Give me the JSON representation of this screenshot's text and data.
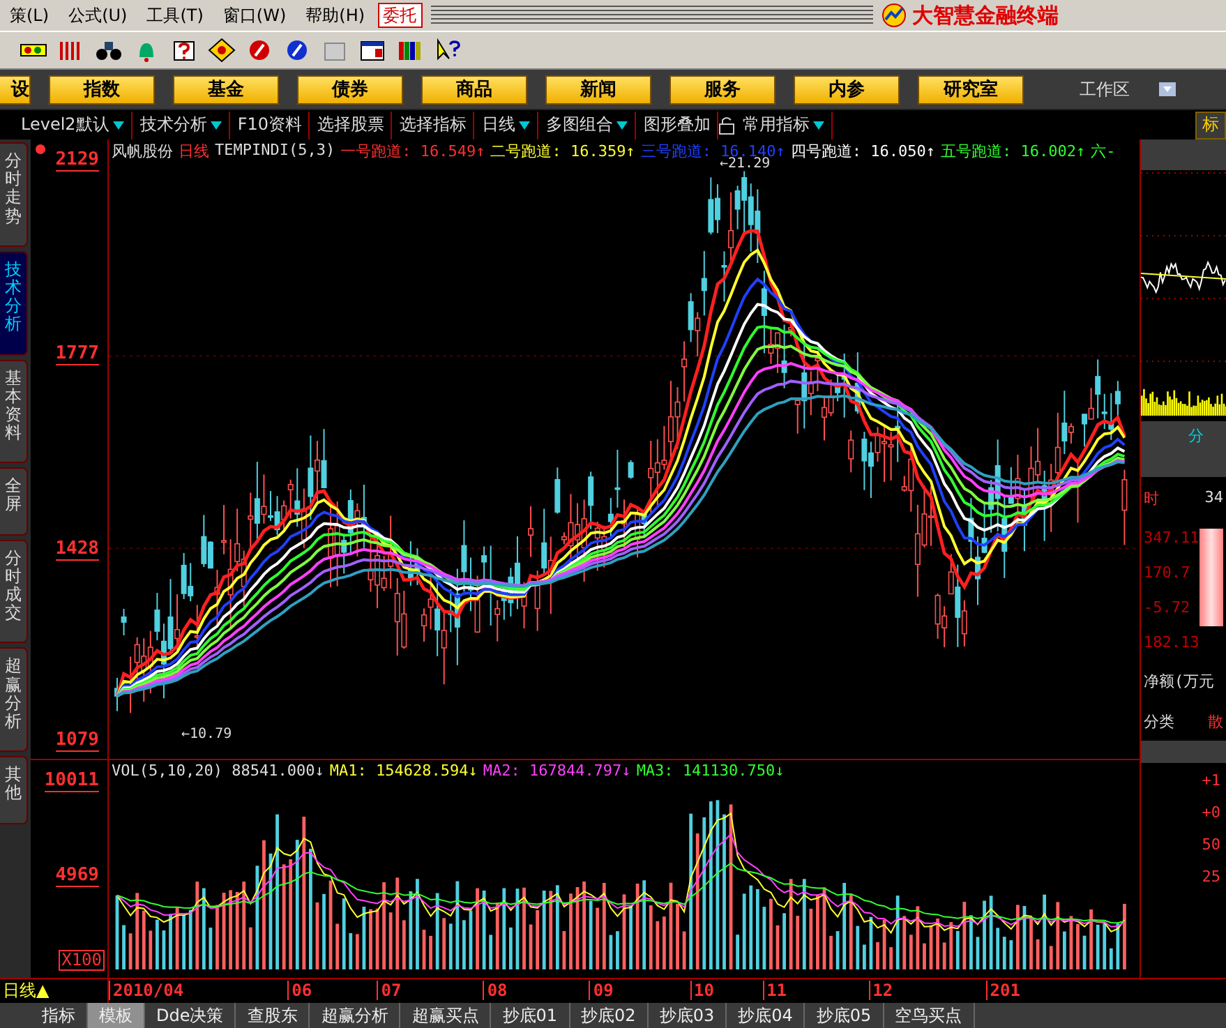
{
  "menu": [
    {
      "label": "策(L)"
    },
    {
      "label": "公式(U)"
    },
    {
      "label": "工具(T)"
    },
    {
      "label": "窗口(W)"
    },
    {
      "label": "帮助(H)"
    }
  ],
  "order_button": "委托",
  "logo": "大智慧金融终端",
  "nav_buttons": [
    "设",
    "指数",
    "基金",
    "债券",
    "商品",
    "新闻",
    "服务",
    "内参",
    "研究室"
  ],
  "workspace": "工作区",
  "tabs": [
    {
      "label": "Level2默认",
      "dropdown": true
    },
    {
      "label": "技术分析",
      "dropdown": true
    },
    {
      "label": "F10资料",
      "dropdown": false
    },
    {
      "label": "选择股票",
      "dropdown": false
    },
    {
      "label": "选择指标",
      "dropdown": false
    },
    {
      "label": "日线",
      "dropdown": true
    },
    {
      "label": "多图组合",
      "dropdown": true
    },
    {
      "label": "图形叠加",
      "dropdown": false
    },
    {
      "label": "常用指标",
      "dropdown": true
    }
  ],
  "side_tabs": [
    {
      "label": "分时走势",
      "selected": false
    },
    {
      "label": "技术分析",
      "selected": true
    },
    {
      "label": "基本资料",
      "selected": false
    },
    {
      "label": "全屏",
      "selected": false
    },
    {
      "label": "分时成交",
      "selected": false
    },
    {
      "label": "超赢分析",
      "selected": false
    },
    {
      "label": "其他",
      "selected": false
    }
  ],
  "chart": {
    "stock": "风帆股份",
    "period": "日线",
    "indicator": "TEMPINDI(5,3)",
    "lines": [
      {
        "label": "一号跑道:",
        "value": "16.549↑",
        "color": "#ff3030"
      },
      {
        "label": "二号跑道:",
        "value": "16.359↑",
        "color": "#ffff30"
      },
      {
        "label": "三号跑道:",
        "value": "16.140↑",
        "color": "#2040ff"
      },
      {
        "label": "四号跑道:",
        "value": "16.050↑",
        "color": "#ffffff"
      },
      {
        "label": "五号跑道:",
        "value": "16.002↑",
        "color": "#30ff30"
      },
      {
        "label": "六-",
        "color": "#30ff30"
      }
    ],
    "price_axis": [
      "2129",
      "1777",
      "1428",
      "1079"
    ],
    "high_note": "←21.29",
    "low_note": "←10.79"
  },
  "volume": {
    "label": "VOL(5,10,20)",
    "value": "88541.000↓",
    "mas": [
      {
        "label": "MA1:",
        "value": "154628.594↓",
        "color": "#ffff30"
      },
      {
        "label": "MA2:",
        "value": "167844.797↓",
        "color": "#ff40ff"
      },
      {
        "label": "MA3:",
        "value": "141130.750↓",
        "color": "#30ff30"
      }
    ],
    "axis": [
      "10011",
      "4969"
    ],
    "unit": "X100"
  },
  "right_panel": {
    "tab": "标",
    "fen": "分",
    "time": "时",
    "bar_value": "34",
    "axis": [
      "347.11",
      "170.7",
      "-5.72",
      "182.13"
    ],
    "net": "净额(万元",
    "category": "分类",
    "retail": "散",
    "vol_marks": [
      "+1",
      "+0",
      "50",
      "25"
    ]
  },
  "date_axis": {
    "period": "日线▲",
    "dates": [
      "2010/04",
      "06",
      "07",
      "08",
      "09",
      "10",
      "11",
      "12",
      "201"
    ]
  },
  "bottom_tabs": [
    {
      "label": "指标",
      "selected": false
    },
    {
      "label": "模板",
      "selected": true
    },
    {
      "label": "Dde决策",
      "selected": false
    },
    {
      "label": "查股东",
      "selected": false
    },
    {
      "label": "超赢分析",
      "selected": false
    },
    {
      "label": "超赢买点",
      "selected": false
    },
    {
      "label": "抄底01",
      "selected": false
    },
    {
      "label": "抄底02",
      "selected": false
    },
    {
      "label": "抄底03",
      "selected": false
    },
    {
      "label": "抄底04",
      "selected": false
    },
    {
      "label": "抄底05",
      "selected": false
    },
    {
      "label": "空鸟买点",
      "selected": false
    }
  ]
}
